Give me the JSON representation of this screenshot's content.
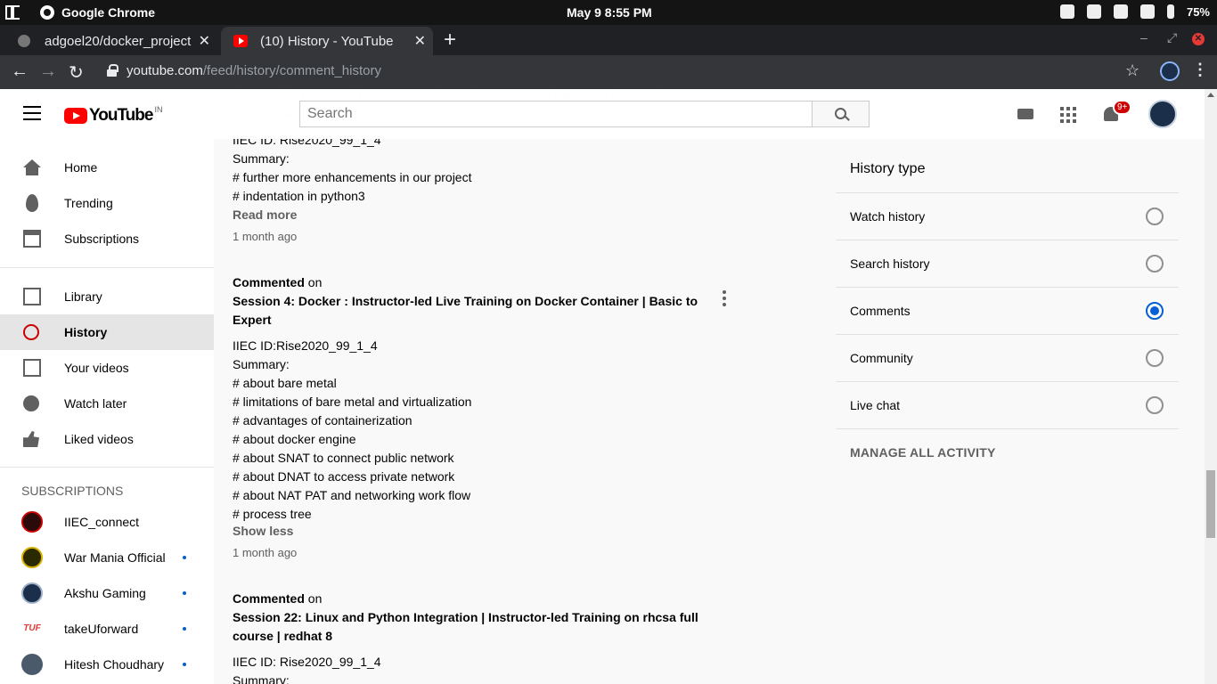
{
  "os": {
    "app_name": "Google Chrome",
    "clock": "May 9   8:55 PM",
    "battery": "75%"
  },
  "tabs": [
    {
      "title": "adgoel20/docker_project"
    },
    {
      "title": "(10) History - YouTube"
    }
  ],
  "address": {
    "host": "youtube.com",
    "path": "/feed/history/comment_history"
  },
  "header": {
    "logo": "YouTube",
    "region": "IN",
    "search_placeholder": "Search",
    "notification_count": "9+"
  },
  "sidebar": {
    "items": [
      {
        "label": "Home"
      },
      {
        "label": "Trending"
      },
      {
        "label": "Subscriptions"
      },
      {
        "label": "Library"
      },
      {
        "label": "History"
      },
      {
        "label": "Your videos"
      },
      {
        "label": "Watch later"
      },
      {
        "label": "Liked videos"
      }
    ],
    "subscriptions_title": "SUBSCRIPTIONS",
    "subscriptions": [
      {
        "name": "IIEC_connect"
      },
      {
        "name": "War Mania Official"
      },
      {
        "name": "Akshu Gaming"
      },
      {
        "name": "takeUforward"
      },
      {
        "name": "Hitesh Choudhary"
      }
    ]
  },
  "comments": {
    "c1": {
      "id": "IIEC ID: Rise2020_99_1_4",
      "summary": "Summary:",
      "lines": [
        "# further more enhancements in our project",
        "# indentation in python3"
      ],
      "toggle": "Read more",
      "time": "1 month ago"
    },
    "c2": {
      "action": "Commented",
      "on": "on",
      "title1": "Session 4: Docker : Instructor-led Live Training on Docker Container | Basic to",
      "title2": "Expert",
      "id": "IIEC ID:Rise2020_99_1_4",
      "summary": "Summary:",
      "lines": [
        "# about bare metal",
        "# limitations of bare metal and virtualization",
        "# advantages of containerization",
        "# about docker engine",
        "# about SNAT to connect public network",
        "# about DNAT to access private network",
        "# about NAT PAT and networking work flow",
        "# process tree"
      ],
      "toggle": "Show less",
      "time": "1 month ago"
    },
    "c3": {
      "action": "Commented",
      "on": "on",
      "title1": "Session 22: Linux and Python Integration | Instructor-led Training on rhcsa full",
      "title2": "course | redhat 8",
      "id": "IIEC ID: Rise2020_99_1_4",
      "summary": "Summary:"
    }
  },
  "history_panel": {
    "title": "History type",
    "options": [
      {
        "label": "Watch history",
        "selected": false
      },
      {
        "label": "Search history",
        "selected": false
      },
      {
        "label": "Comments",
        "selected": true
      },
      {
        "label": "Community",
        "selected": false
      },
      {
        "label": "Live chat",
        "selected": false
      }
    ],
    "manage": "MANAGE ALL ACTIVITY"
  },
  "colors": {
    "accent": "#065fd4",
    "yt_red": "#ff0000",
    "history_red": "#cc0000"
  }
}
